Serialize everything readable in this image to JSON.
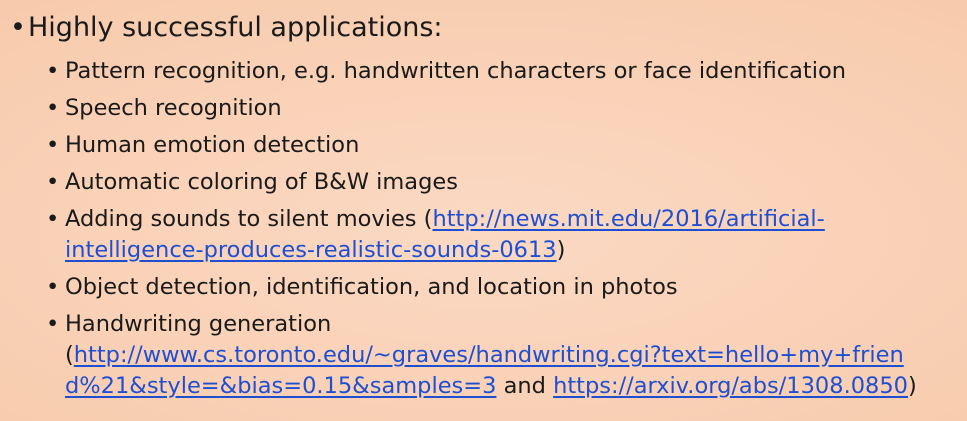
{
  "main_bullet": "Highly successful applications:",
  "items": [
    {
      "text": "Pattern recognition, e.g. handwritten characters or face identification"
    },
    {
      "text": "Speech recognition"
    },
    {
      "text": "Human emotion detection"
    },
    {
      "text": "Automatic coloring of B&W images"
    },
    {
      "text_before": "Adding sounds to silent movies (",
      "link_line1": "http://news.mit.edu/2016/artificial-",
      "link_line2": "intelligence-produces-realistic-sounds-0613",
      "text_after": ")"
    },
    {
      "text": "Object detection, identification, and location in photos"
    },
    {
      "text": "Handwriting generation",
      "open_paren": "(",
      "link1_line1": "http://www.cs.toronto.edu/~graves/handwriting.cgi?text=hello+my+frien",
      "link1_line2": "d%21&style=&bias=0.15&samples=3",
      "and": " and ",
      "link2": "https://arxiv.org/abs/1308.0850",
      "close_paren": ")"
    }
  ],
  "bullet_glyph": "•"
}
